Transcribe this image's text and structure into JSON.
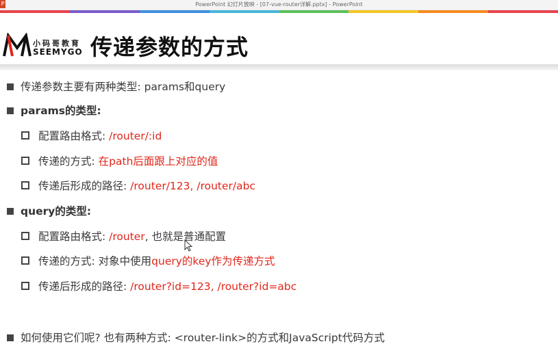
{
  "window": {
    "app_icon": "powerpoint-icon",
    "title": "PowerPoint 幻灯片放映 - [07-vue-router详解.pptx] - PowerPoint"
  },
  "colors": {
    "accent_red": "#e0261a",
    "band": [
      "#e8434b",
      "#7a5cc8",
      "#3f8fe0",
      "#46b6d8",
      "#5bbf5a",
      "#f3c623",
      "#f58a1f",
      "#e8434b"
    ]
  },
  "logo": {
    "icon": "seemygo-logo",
    "cn": "小码哥教育",
    "en": "SEEMYGO"
  },
  "slide": {
    "title": "传递参数的方式",
    "bullets": [
      {
        "text": "传递参数主要有两种类型: params和query"
      },
      {
        "text": "params的类型:"
      },
      {
        "label": "配置路由格式: ",
        "value": "/router/:id"
      },
      {
        "label": "传递的方式: ",
        "value": "在path后面跟上对应的值"
      },
      {
        "label": "传递后形成的路径: ",
        "value": "/router/123, /router/abc"
      },
      {
        "text": "query的类型:"
      },
      {
        "label": "配置路由格式: ",
        "value": "/router",
        "rest": ", 也就是普通配置"
      },
      {
        "label": "传递的方式: 对象中使用",
        "value": "query的key作为传递方式"
      },
      {
        "label": "传递后形成的路径: ",
        "value": "/router?id=123, /router?id=abc"
      },
      {
        "text": "如何使用它们呢? 也有两种方式: <router-link>的方式和JavaScript代码方式"
      }
    ]
  },
  "cursor": "mouse-pointer-icon"
}
